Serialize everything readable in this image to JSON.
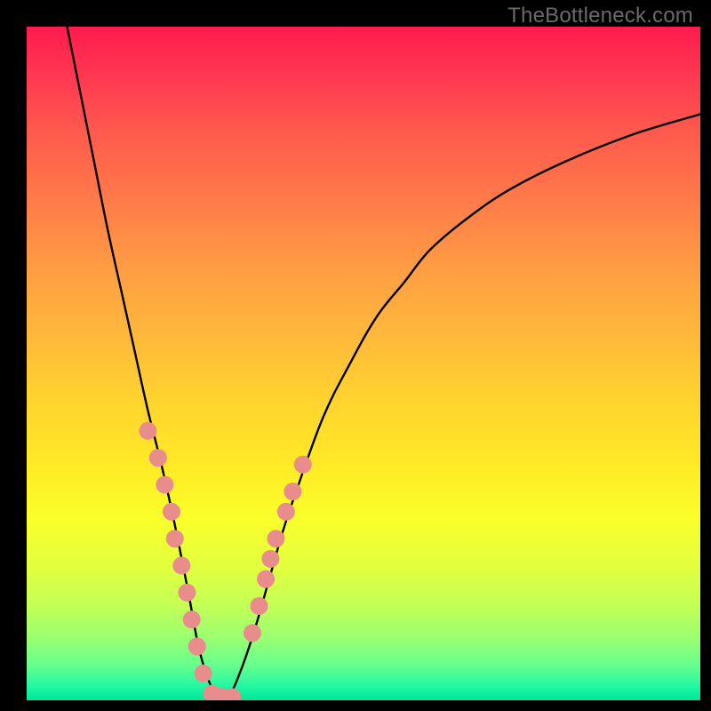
{
  "watermark": "TheBottleneck.com",
  "chart_data": {
    "type": "line",
    "title": "",
    "xlabel": "",
    "ylabel": "",
    "xlim": [
      0,
      100
    ],
    "ylim": [
      0,
      100
    ],
    "background_gradient": {
      "direction": "vertical",
      "stops": [
        {
          "pos": 0,
          "color": "#ff1a4d"
        },
        {
          "pos": 50,
          "color": "#ffd22f"
        },
        {
          "pos": 85,
          "color": "#c3ff56"
        },
        {
          "pos": 100,
          "color": "#00e69a"
        }
      ]
    },
    "series": [
      {
        "name": "bottleneck-curve",
        "color": "#000000",
        "x": [
          6,
          8,
          10,
          12,
          14,
          16,
          18,
          20,
          22,
          24,
          25.5,
          27,
          28.5,
          30,
          32,
          34,
          36,
          38,
          40,
          44,
          48,
          52,
          56,
          60,
          66,
          72,
          80,
          90,
          100
        ],
        "y": [
          100,
          90,
          80,
          70,
          61,
          52,
          43,
          35,
          26,
          16,
          8,
          3,
          0,
          0.5,
          5,
          11,
          18,
          25,
          31,
          42,
          50,
          57,
          62,
          67,
          72,
          76,
          80,
          84,
          87
        ]
      }
    ],
    "markers": [
      {
        "name": "left-branch-dots",
        "color": "#e98c8c",
        "radius": 10,
        "points": [
          {
            "x": 18.0,
            "y": 40
          },
          {
            "x": 19.5,
            "y": 36
          },
          {
            "x": 20.5,
            "y": 32
          },
          {
            "x": 21.5,
            "y": 28
          },
          {
            "x": 22.0,
            "y": 24
          },
          {
            "x": 23.0,
            "y": 20
          },
          {
            "x": 23.8,
            "y": 16
          },
          {
            "x": 24.5,
            "y": 12
          },
          {
            "x": 25.3,
            "y": 8
          },
          {
            "x": 26.2,
            "y": 4
          },
          {
            "x": 27.5,
            "y": 1
          },
          {
            "x": 29.0,
            "y": 0.5
          },
          {
            "x": 30.5,
            "y": 0.5
          }
        ]
      },
      {
        "name": "right-branch-dots",
        "color": "#e98c8c",
        "radius": 10,
        "points": [
          {
            "x": 33.5,
            "y": 10
          },
          {
            "x": 34.5,
            "y": 14
          },
          {
            "x": 35.5,
            "y": 18
          },
          {
            "x": 36.2,
            "y": 21
          },
          {
            "x": 37.0,
            "y": 24
          },
          {
            "x": 38.5,
            "y": 28
          },
          {
            "x": 39.5,
            "y": 31
          },
          {
            "x": 41.0,
            "y": 35
          }
        ]
      }
    ]
  }
}
